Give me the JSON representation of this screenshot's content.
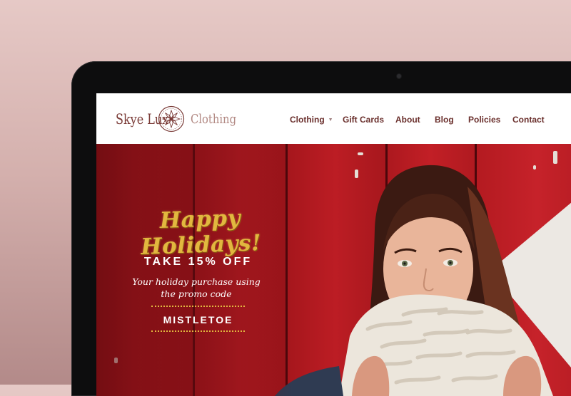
{
  "brand": {
    "name_left": "Skye Lux",
    "name_right": "Clothing",
    "logo_icon": "mandala-icon"
  },
  "nav": {
    "items": [
      {
        "label": "Clothing",
        "has_dropdown": true
      },
      {
        "label": "Gift Cards"
      },
      {
        "label": "About"
      },
      {
        "label": "Blog"
      },
      {
        "label": "Policies"
      },
      {
        "label": "Contact"
      }
    ],
    "dropdown_icon": "caret-down-icon"
  },
  "hero": {
    "headline": "Happy Holidays!",
    "offer": "TAKE 15% OFF",
    "subtext_line1": "Your holiday purchase using",
    "subtext_line2": "the promo code",
    "promo_code": "MISTLETOE"
  },
  "colors": {
    "brand_dark": "#7a3b37",
    "brand_light": "#b28983",
    "nav_text": "#6a2f2c",
    "hero_red": "#a8161d",
    "gold": "#e2b73f",
    "background_pink": "#d4b0ad"
  }
}
